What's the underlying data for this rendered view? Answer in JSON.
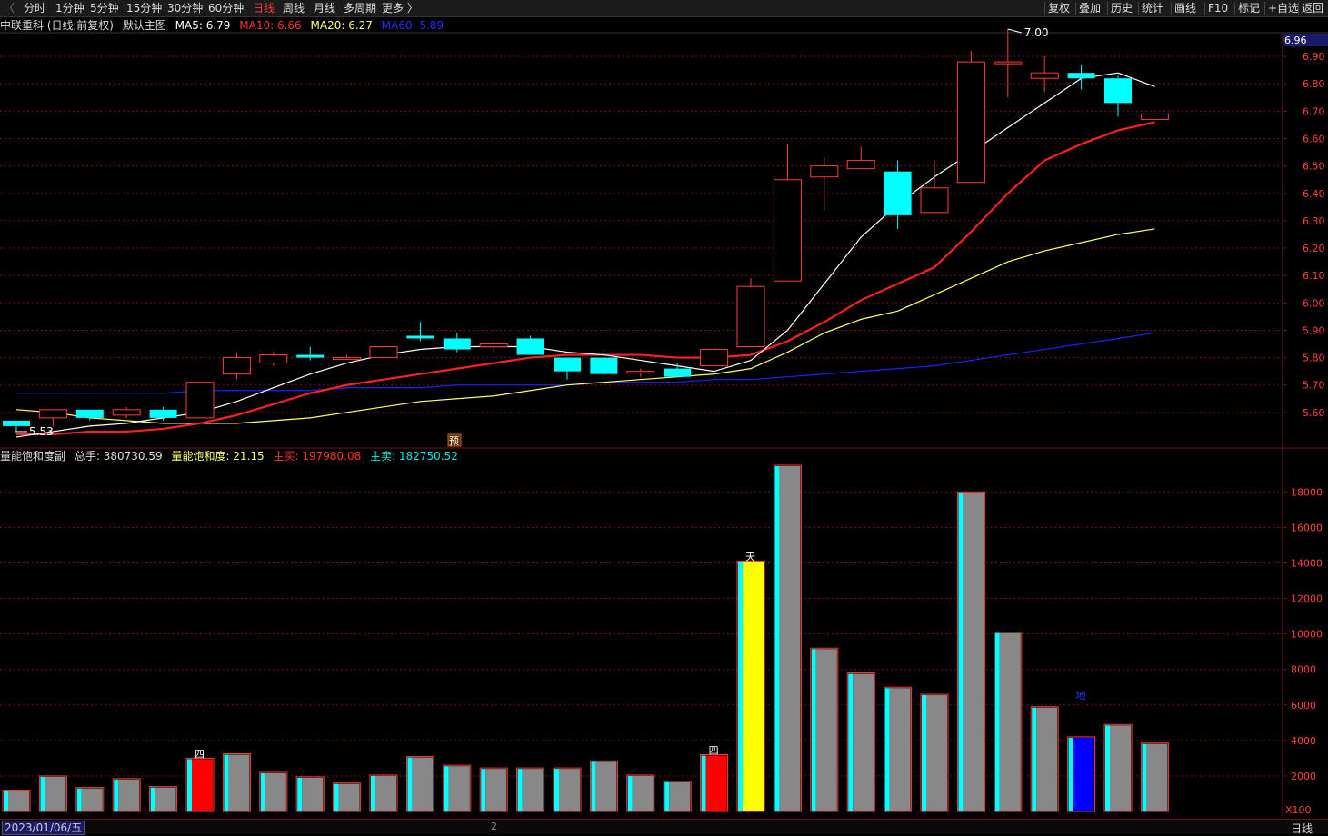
{
  "toolbar": {
    "periods": [
      "分时",
      "1分钟",
      "5分钟",
      "15分钟",
      "30分钟",
      "60分钟",
      "日线",
      "周线",
      "月线",
      "多周期",
      "更多 〉"
    ],
    "active_period": "日线",
    "right_buttons": [
      "复权",
      "叠加",
      "历史",
      "统计",
      "画线",
      "F10",
      "标记",
      "+自选",
      "返回"
    ]
  },
  "main_info": {
    "stock": "中联重科 (日线,前复权)",
    "template": "默认主图",
    "ma5": "MA5: 6.79",
    "ma10": "MA10: 6.66",
    "ma20": "MA20: 6.27",
    "ma60": "MA60: 5.89"
  },
  "volume_info": {
    "indicator": "量能饱和度副",
    "total": "总手: 380730.59",
    "saturation": "量能饱和度: 21.15",
    "main_buy": "主买: 197980.08",
    "main_sell": "主卖: 182750.52"
  },
  "colors": {
    "up": "#ff3b3b",
    "down": "#00ffff",
    "ma5": "#ffffff",
    "ma10": "#ff2020",
    "ma20": "#ffff66",
    "ma60": "#2020ff",
    "grid": "#7a1010",
    "volume_gray": "#888888",
    "volume_highlight_red": "#ff0000",
    "volume_highlight_yellow": "#ffff00",
    "volume_highlight_blue": "#0000ff"
  },
  "chart_data": [
    {
      "type": "candlestick",
      "price_axis_ticks": [
        5.6,
        5.7,
        5.8,
        5.9,
        6.0,
        6.1,
        6.2,
        6.3,
        6.4,
        6.5,
        6.6,
        6.7,
        6.8,
        6.9
      ],
      "price_axis_labels": [
        "5.60",
        "5.70",
        "5.80",
        "5.90",
        "6.00",
        "6.10",
        "6.20",
        "6.30",
        "6.40",
        "6.50",
        "6.60",
        "6.70",
        "6.80",
        "6.90"
      ],
      "current_price_label": "6.96",
      "high_marker": "7.00",
      "low_marker": "5.53",
      "forecast_marker": "预",
      "ylim": [
        5.48,
        6.98
      ],
      "candles": [
        {
          "o": 5.57,
          "h": 5.57,
          "c": 5.55,
          "l": 5.53
        },
        {
          "o": 5.58,
          "h": 5.61,
          "c": 5.61,
          "l": 5.55
        },
        {
          "o": 5.61,
          "h": 5.61,
          "c": 5.58,
          "l": 5.57
        },
        {
          "o": 5.59,
          "h": 5.62,
          "c": 5.61,
          "l": 5.58
        },
        {
          "o": 5.61,
          "h": 5.62,
          "c": 5.58,
          "l": 5.57
        },
        {
          "o": 5.58,
          "h": 5.71,
          "c": 5.71,
          "l": 5.58
        },
        {
          "o": 5.74,
          "h": 5.82,
          "c": 5.8,
          "l": 5.72
        },
        {
          "o": 5.78,
          "h": 5.82,
          "c": 5.81,
          "l": 5.77
        },
        {
          "o": 5.81,
          "h": 5.84,
          "c": 5.8,
          "l": 5.79
        },
        {
          "o": 5.8,
          "h": 5.81,
          "c": 5.8,
          "l": 5.8
        },
        {
          "o": 5.8,
          "h": 5.84,
          "c": 5.84,
          "l": 5.8
        },
        {
          "o": 5.88,
          "h": 5.93,
          "c": 5.87,
          "l": 5.86
        },
        {
          "o": 5.87,
          "h": 5.89,
          "c": 5.83,
          "l": 5.82
        },
        {
          "o": 5.84,
          "h": 5.86,
          "c": 5.85,
          "l": 5.82
        },
        {
          "o": 5.87,
          "h": 5.88,
          "c": 5.81,
          "l": 5.81
        },
        {
          "o": 5.8,
          "h": 5.8,
          "c": 5.75,
          "l": 5.72
        },
        {
          "o": 5.8,
          "h": 5.83,
          "c": 5.74,
          "l": 5.72
        },
        {
          "o": 5.75,
          "h": 5.76,
          "c": 5.75,
          "l": 5.73
        },
        {
          "o": 5.76,
          "h": 5.78,
          "c": 5.73,
          "l": 5.73
        },
        {
          "o": 5.77,
          "h": 5.84,
          "c": 5.83,
          "l": 5.72
        },
        {
          "o": 5.84,
          "h": 6.09,
          "c": 6.06,
          "l": 5.84
        },
        {
          "o": 6.08,
          "h": 6.58,
          "c": 6.45,
          "l": 6.08
        },
        {
          "o": 6.46,
          "h": 6.53,
          "c": 6.5,
          "l": 6.34
        },
        {
          "o": 6.49,
          "h": 6.57,
          "c": 6.52,
          "l": 6.49
        },
        {
          "o": 6.48,
          "h": 6.52,
          "c": 6.32,
          "l": 6.27
        },
        {
          "o": 6.33,
          "h": 6.52,
          "c": 6.42,
          "l": 6.33
        },
        {
          "o": 6.44,
          "h": 6.92,
          "c": 6.88,
          "l": 6.44
        },
        {
          "o": 6.88,
          "h": 7.0,
          "c": 6.88,
          "l": 6.75
        },
        {
          "o": 6.82,
          "h": 6.9,
          "c": 6.84,
          "l": 6.77
        },
        {
          "o": 6.84,
          "h": 6.87,
          "c": 6.82,
          "l": 6.78
        },
        {
          "o": 6.82,
          "h": 6.83,
          "c": 6.73,
          "l": 6.68
        },
        {
          "o": 6.67,
          "h": 6.69,
          "c": 6.69,
          "l": 6.67
        }
      ],
      "ma5": [
        5.51,
        5.53,
        5.55,
        5.56,
        5.58,
        5.6,
        5.64,
        5.69,
        5.74,
        5.78,
        5.81,
        5.83,
        5.84,
        5.84,
        5.84,
        5.82,
        5.81,
        5.79,
        5.77,
        5.75,
        5.79,
        5.9,
        6.07,
        6.24,
        6.36,
        6.46,
        6.55,
        6.64,
        6.73,
        6.82,
        6.84,
        6.79
      ],
      "ma10": [
        5.52,
        5.52,
        5.53,
        5.53,
        5.54,
        5.56,
        5.59,
        5.63,
        5.67,
        5.7,
        5.72,
        5.74,
        5.76,
        5.78,
        5.8,
        5.81,
        5.81,
        5.81,
        5.8,
        5.8,
        5.81,
        5.86,
        5.93,
        6.01,
        6.07,
        6.13,
        6.26,
        6.4,
        6.52,
        6.58,
        6.63,
        6.66
      ],
      "ma20": [
        5.61,
        5.6,
        5.58,
        5.57,
        5.56,
        5.56,
        5.56,
        5.57,
        5.58,
        5.6,
        5.62,
        5.64,
        5.65,
        5.66,
        5.68,
        5.7,
        5.71,
        5.72,
        5.73,
        5.74,
        5.76,
        5.82,
        5.89,
        5.94,
        5.97,
        6.03,
        6.09,
        6.15,
        6.19,
        6.22,
        6.25,
        6.27
      ],
      "ma60": [
        5.67,
        5.67,
        5.67,
        5.67,
        5.67,
        5.68,
        5.68,
        5.68,
        5.68,
        5.69,
        5.69,
        5.69,
        5.7,
        5.7,
        5.7,
        5.7,
        5.71,
        5.71,
        5.71,
        5.72,
        5.72,
        5.73,
        5.74,
        5.75,
        5.76,
        5.77,
        5.79,
        5.81,
        5.83,
        5.85,
        5.87,
        5.89
      ]
    },
    {
      "type": "bar",
      "title": "量能饱和度副",
      "axis_ticks": [
        2000,
        4000,
        6000,
        8000,
        10000,
        12000,
        14000,
        16000,
        18000
      ],
      "axis_labels": [
        "2000",
        "4000",
        "6000",
        "8000",
        "10000",
        "12000",
        "14000",
        "16000",
        "18000"
      ],
      "axis_unit": "X100",
      "ylim": [
        0,
        19500
      ],
      "values": [
        1200,
        2000,
        1350,
        1850,
        1400,
        3000,
        3250,
        2200,
        1950,
        1600,
        2050,
        3100,
        2600,
        2450,
        2450,
        2450,
        2850,
        2050,
        1700,
        3200,
        14100,
        19500,
        9200,
        7800,
        7000,
        6600,
        18000,
        10100,
        5900,
        4200,
        4900,
        3850
      ],
      "styles": [
        "gray",
        "gray",
        "gray",
        "gray",
        "gray",
        "red",
        "gray",
        "gray",
        "gray",
        "gray",
        "gray",
        "gray",
        "gray",
        "gray",
        "gray",
        "gray",
        "gray",
        "gray",
        "gray",
        "red",
        "yellow",
        "gray",
        "gray",
        "gray",
        "gray",
        "gray",
        "gray",
        "gray",
        "gray",
        "blue",
        "gray",
        "gray"
      ],
      "marker_labels": [
        {
          "index": 5,
          "text": "四"
        },
        {
          "index": 19,
          "text": "四"
        },
        {
          "index": 20,
          "text": "天"
        },
        {
          "index": 29,
          "text": "地"
        }
      ]
    }
  ],
  "bottom": {
    "date": "2023/01/06/五",
    "mark": "2",
    "period": "日线"
  }
}
